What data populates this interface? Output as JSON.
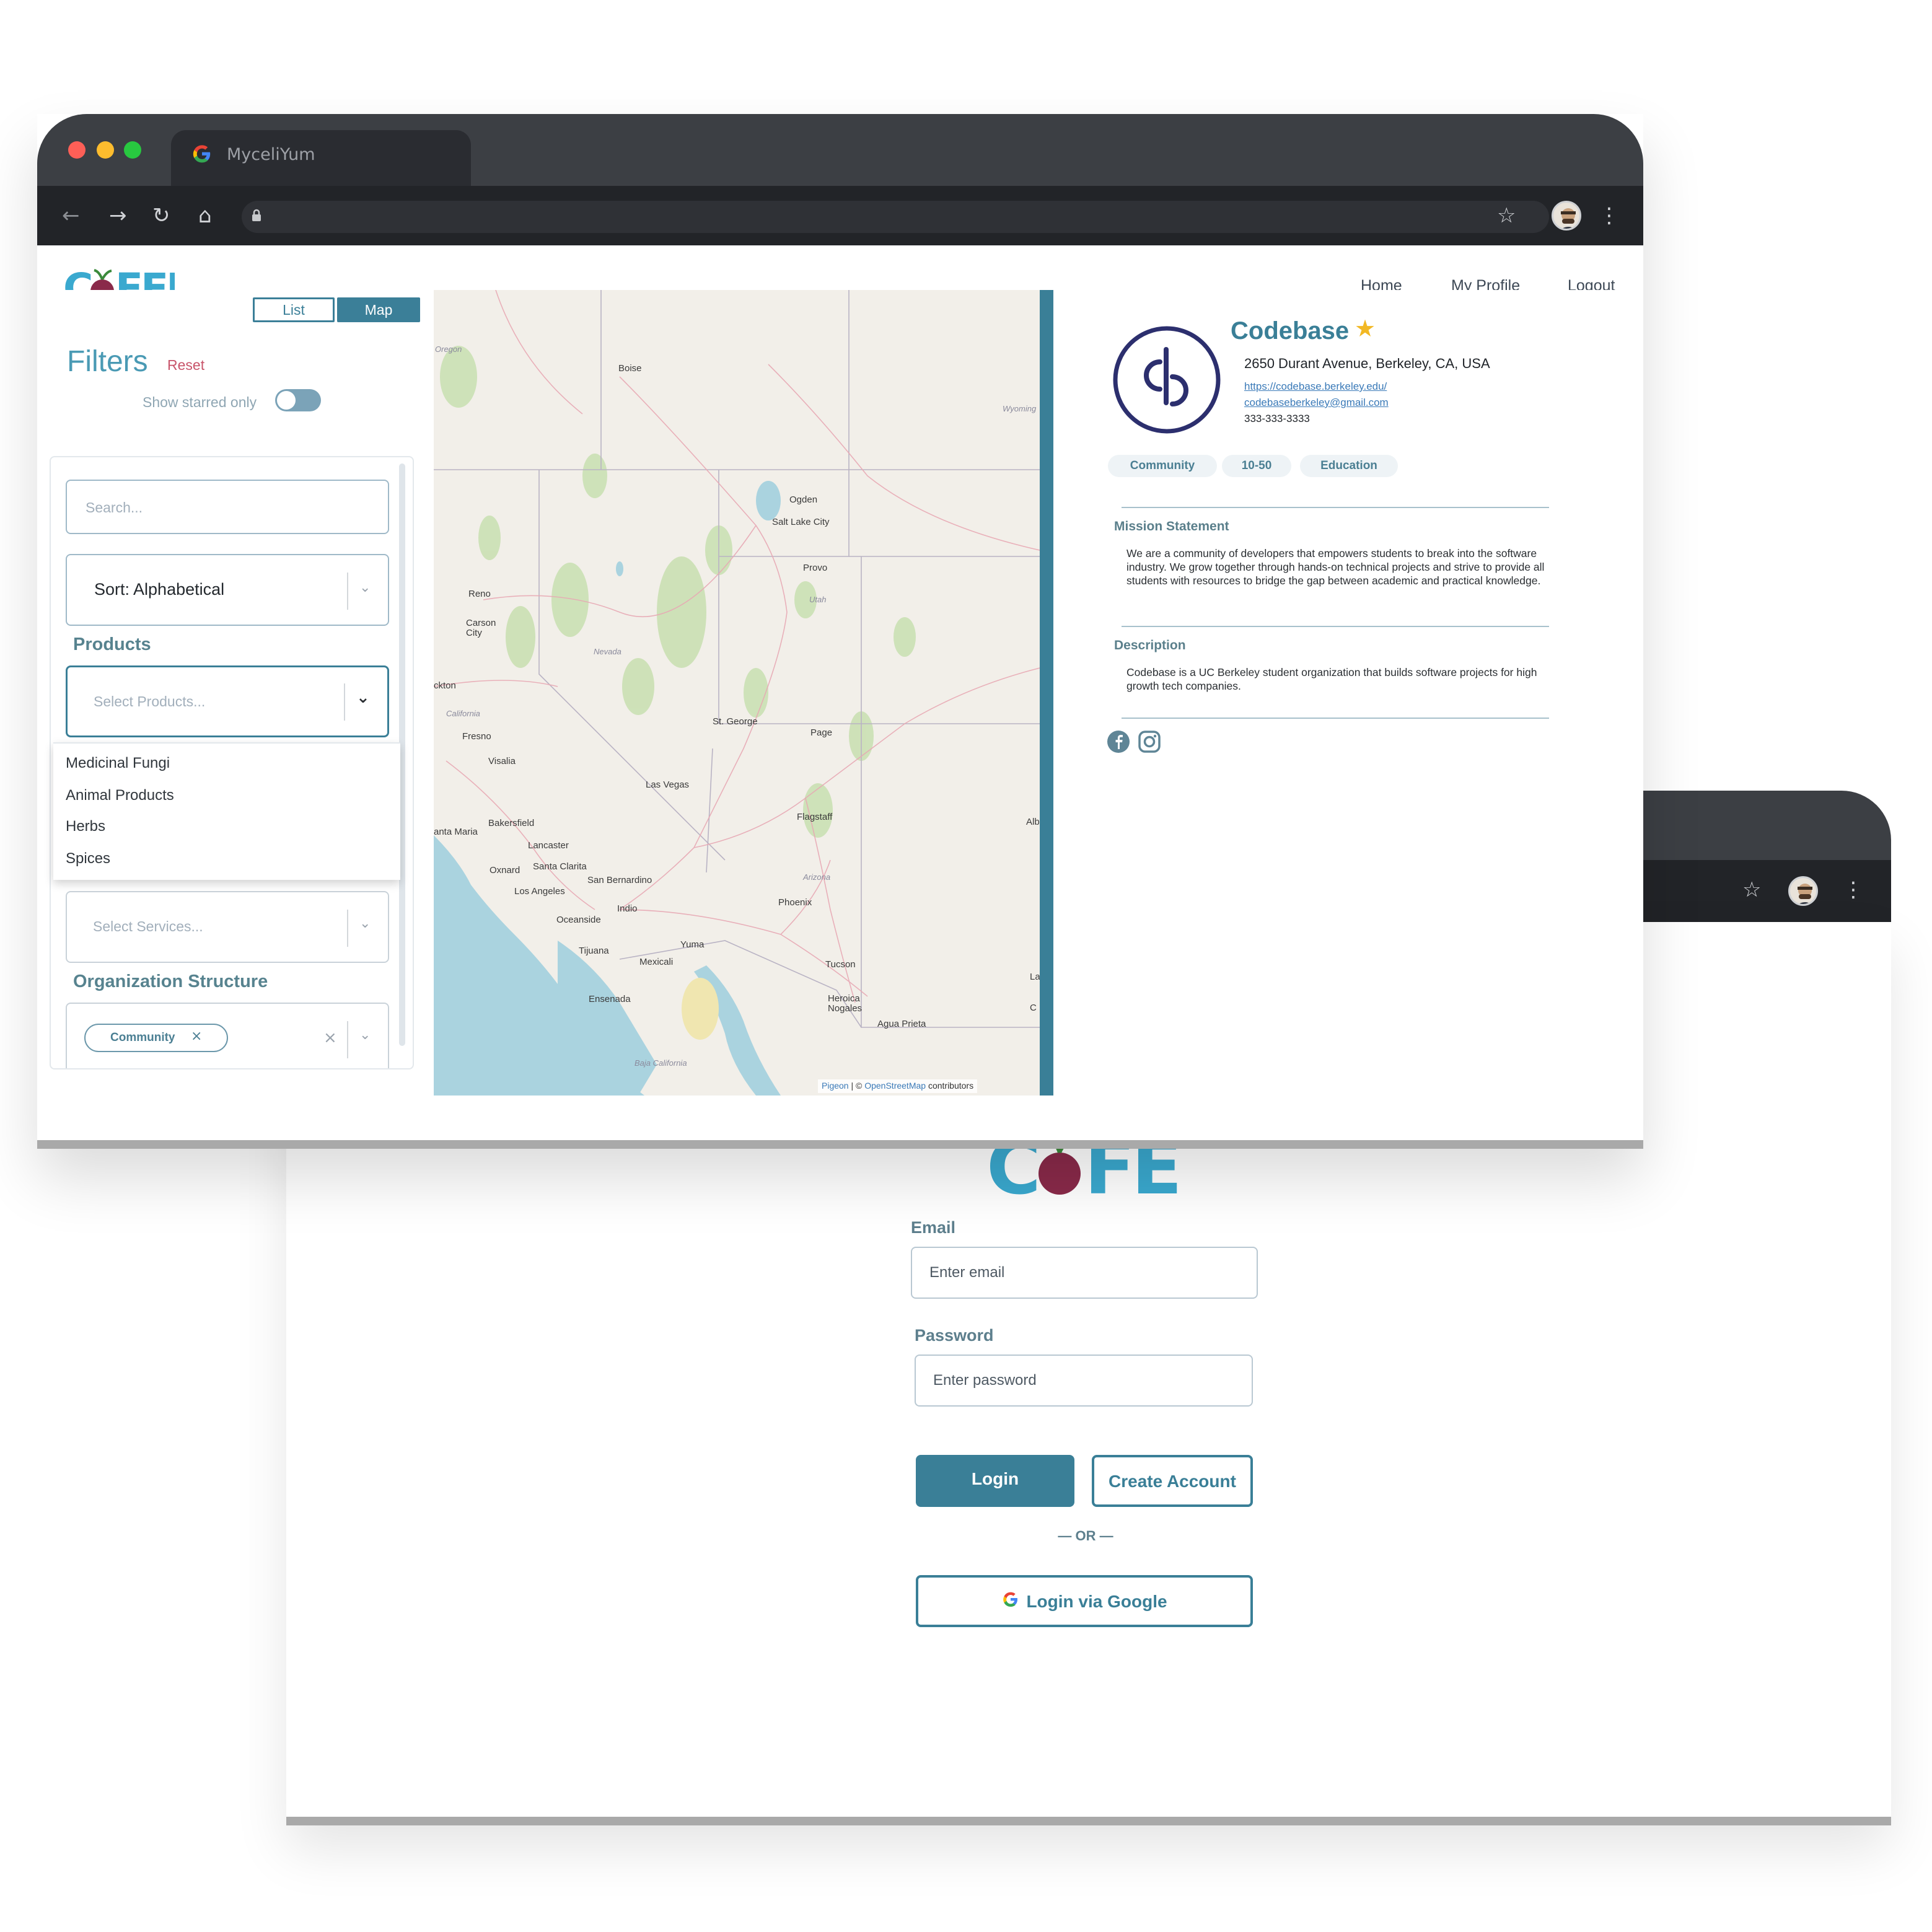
{
  "browser": {
    "tab_title": "MyceliYum",
    "nav_glyphs": {
      "back": "←",
      "forward": "→",
      "reload": "↻",
      "home": "⌂",
      "lock": "🔒",
      "star": "☆",
      "menu": "⋮"
    }
  },
  "header": {
    "logo": "COFED",
    "nav": [
      {
        "label": "Home"
      },
      {
        "label": "My Profile"
      },
      {
        "label": "Logout"
      }
    ]
  },
  "view_toggle": {
    "list": "List",
    "map": "Map",
    "active": "Map"
  },
  "filters": {
    "title": "Filters",
    "reset": "Reset",
    "starred_toggle_label": "Show starred only",
    "starred_only": false,
    "search_placeholder": "Search...",
    "sort_value": "Sort: Alphabetical",
    "products_label": "Products",
    "products_placeholder": "Select Products...",
    "products_options": [
      "Medicinal Fungi",
      "Animal Products",
      "Herbs",
      "Spices"
    ],
    "services_placeholder": "Select Services...",
    "org_structure_label": "Organization Structure",
    "org_structure_chip": "Community",
    "chip_remove": "×",
    "clear": "×"
  },
  "map": {
    "cities": [
      "Boise",
      "Ogden",
      "Salt Lake City",
      "Provo",
      "Reno",
      "Carson City",
      "Fresno",
      "Visalia",
      "St. George",
      "Page",
      "Las Vegas",
      "Bakersfield",
      "Lancaster",
      "Santa Clarita",
      "Oxnard",
      "Los Angeles",
      "San Bernardino",
      "Indio",
      "Oceanside",
      "Flagstaff",
      "Phoenix",
      "Tijuana",
      "Yuma",
      "Mexicali",
      "Tucson",
      "Ensenada",
      "Heroica Nogales",
      "Agua Prieta",
      "ckton",
      "anta Maria",
      "Alb",
      "La",
      "C"
    ],
    "states": [
      "Oregon",
      "Wyoming",
      "Nevada",
      "Utah",
      "California",
      "Arizona",
      "Baja California"
    ],
    "attribution_link1": "Pigeon",
    "attribution_mid": " | © ",
    "attribution_link2": "OpenStreetMap",
    "attribution_end": " contributors"
  },
  "organization": {
    "name": "Codebase",
    "starred": true,
    "address": "2650 Durant Avenue, Berkeley, CA, USA",
    "website": "https://codebase.berkeley.edu/",
    "email": "codebaseberkeley@gmail.com",
    "phone": "333-333-3333",
    "tags": [
      "Community",
      "10-50",
      "Education"
    ],
    "mission_heading": "Mission Statement",
    "mission_text": "We are a community of developers that empowers students to break into the software industry. We grow together through hands-on technical projects and strive to provide all students with resources to bridge the gap between academic and practical knowledge.",
    "description_heading": "Description",
    "description_text": "Codebase is a UC Berkeley student organization that builds software projects for high growth tech companies.",
    "socials": [
      "facebook-icon",
      "instagram-icon"
    ]
  },
  "login": {
    "email_label": "Email",
    "email_placeholder": "Enter email",
    "password_label": "Password",
    "password_placeholder": "Enter password",
    "login_button": "Login",
    "create_button": "Create Account",
    "divider": "— OR —",
    "google_button": "Login via Google"
  },
  "colors": {
    "primary": "#3a7f97",
    "brand_blue": "#3aa9cf",
    "beet": "#8a2a4a",
    "star": "#f2b824",
    "reset": "#c8546a",
    "chrome_dark": "#222428",
    "chrome_tab": "#3c3f44"
  }
}
